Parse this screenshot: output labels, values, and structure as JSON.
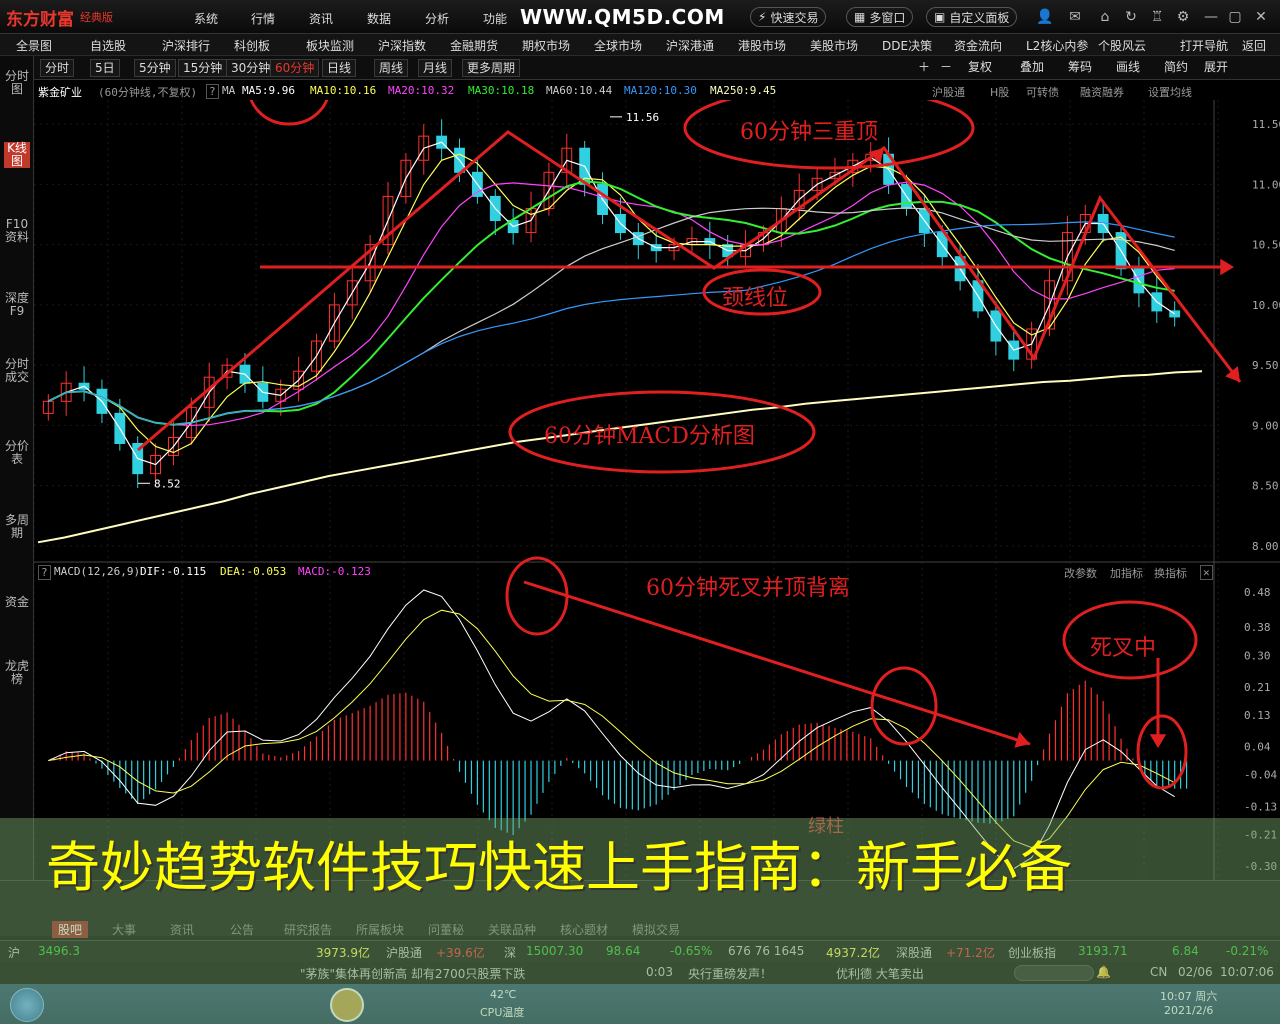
{
  "app": {
    "logo": "东方财富",
    "edition": "经典版",
    "watermark": "WWW.QM5D.COM",
    "menu": [
      "系统",
      "行情",
      "资讯",
      "数据",
      "分析",
      "功能"
    ],
    "pills": [
      "快速交易",
      "多窗口",
      "自定义面板"
    ]
  },
  "nav": [
    "全景图",
    "自选股",
    "沪深排行",
    "科创板",
    "板块监测",
    "沪深指数",
    "金融期货",
    "期权市场",
    "全球市场",
    "沪深港通",
    "港股市场",
    "美股市场",
    "DDE决策",
    "资金流向",
    "L2核心内参",
    "个股风云",
    "打开导航",
    "返回"
  ],
  "leftbar": [
    "分时图",
    "K线图",
    "F10资料",
    "深度F9",
    "分时成交",
    "分价表",
    "多周期",
    "资金",
    "龙虎榜"
  ],
  "periods": [
    "分时",
    "5日",
    "5分钟",
    "15分钟",
    "30分钟",
    "60分钟",
    "日线",
    "周线",
    "月线",
    "更多周期"
  ],
  "active_period": "60分钟",
  "tools": [
    "复权",
    "叠加",
    "筹码",
    "画线",
    "简约",
    "展开"
  ],
  "info": {
    "stock": "紫金矿业",
    "mode": "(60分钟线,不复权)",
    "ma_label": "MA",
    "ma5": "MA5:9.96",
    "ma10": "MA10:10.16",
    "ma20": "MA20:10.32",
    "ma30": "MA30:10.18",
    "ma60": "MA60:10.44",
    "ma120": "MA120:10.30",
    "ma250": "MA250:9.45",
    "right": [
      "沪股通",
      "H股",
      "可转债",
      "融资融券",
      "设置均线"
    ]
  },
  "macd": {
    "label": "MACD(12,26,9)",
    "dif": "DIF:-0.115",
    "dea": "DEA:-0.053",
    "macd": "MACD:-0.123",
    "right": [
      "改参数",
      "加指标",
      "换指标"
    ]
  },
  "price_axis": [
    "11.50",
    "11.00",
    "10.50",
    "10.00",
    "9.50",
    "9.00",
    "8.50",
    "8.00"
  ],
  "macd_axis": [
    "0.48",
    "0.38",
    "0.30",
    "0.21",
    "0.13",
    "0.04",
    "-0.04",
    "-0.13",
    "-0.21",
    "-0.30"
  ],
  "marks": {
    "high": "11.56",
    "low": "8.52"
  },
  "annotations": {
    "triple_top": "60分钟三重顶",
    "neckline": "颈线位",
    "macd_title": "60分钟MACD分析图",
    "death_cross": "60分钟死叉并顶背离",
    "in_cross": "死叉中",
    "green_bar": "绿柱"
  },
  "bottom_tabs": [
    "股吧",
    "大事",
    "资讯",
    "公告",
    "研究报告",
    "所属板块",
    "问董秘",
    "关联品种",
    "核心题材",
    "模拟交易"
  ],
  "ticker": {
    "sh_label": "沪",
    "sh_val": "3496.3",
    "sh_amt": "3973.9亿",
    "hgt": "沪股通",
    "hgt_val": "+39.6亿",
    "sz_label": "深",
    "sz_val": "15007.30",
    "sz_chg": "98.64",
    "sz_pct": "-0.65%",
    "sz_cnt": "676 76 1645",
    "sz_amt": "4937.2亿",
    "sgt": "深股通",
    "sgt_val": "+71.2亿",
    "cyb": "创业板指",
    "cyb_val": "3193.71",
    "cyb_chg": "6.84",
    "cyb_pct": "-0.21%"
  },
  "news": {
    "text": "\"茅族\"集体再创新高 却有2700只股票下跌",
    "time": "0:03",
    "text2": "央行重磅发声！",
    "text3": "优利德 大笔卖出",
    "market": "CN",
    "date": "02/06",
    "clock": "10:07:06"
  },
  "taskbar": {
    "temp": "42℃",
    "temp_label": "CPU温度",
    "time": "10:07 周六",
    "date": "2021/2/6"
  },
  "banner": "奇妙趋势软件技巧快速上手指南：新手必备",
  "colors": {
    "up": "#ff3030",
    "down": "#30d0e0",
    "ma5": "#ffffff",
    "ma10": "#ffff55",
    "ma20": "#ff44ff",
    "ma30": "#33ee33",
    "ma60": "#cccccc",
    "ma120": "#3399ff",
    "ma250": "#fffcc0",
    "annot": "#e02020"
  },
  "chart_data": {
    "type": "line",
    "title": "紫金矿业 (60分钟线,不复权)",
    "ylim": [
      7.9,
      11.7
    ],
    "series": [
      {
        "name": "收盘",
        "values": [
          9.2,
          9.35,
          9.3,
          9.1,
          8.85,
          8.6,
          8.75,
          8.9,
          9.15,
          9.4,
          9.5,
          9.35,
          9.2,
          9.3,
          9.45,
          9.7,
          10.0,
          10.2,
          10.5,
          10.9,
          11.2,
          11.4,
          11.3,
          11.1,
          10.9,
          10.7,
          10.6,
          10.8,
          11.1,
          11.3,
          11.0,
          10.75,
          10.6,
          10.5,
          10.45,
          10.5,
          10.55,
          10.5,
          10.4,
          10.5,
          10.6,
          10.8,
          10.95,
          11.05,
          11.1,
          11.2,
          11.25,
          11.0,
          10.8,
          10.6,
          10.4,
          10.2,
          9.95,
          9.7,
          9.55,
          9.8,
          10.2,
          10.6,
          10.75,
          10.6,
          10.3,
          10.1,
          9.95,
          9.9
        ]
      },
      {
        "name": "MA250",
        "values": [
          8.03,
          8.07,
          8.12,
          8.17,
          8.22,
          8.27,
          8.32,
          8.37,
          8.43,
          8.48,
          8.53,
          8.58,
          8.62,
          8.66,
          8.7,
          8.74,
          8.78,
          8.82,
          8.86,
          8.89,
          8.92,
          8.95,
          8.98,
          9.01,
          9.04,
          9.07,
          9.1,
          9.13,
          9.15,
          9.18,
          9.2,
          9.22,
          9.24,
          9.26,
          9.28,
          9.3,
          9.32,
          9.34,
          9.36,
          9.37,
          9.39,
          9.41,
          9.42,
          9.44,
          9.45
        ]
      }
    ]
  }
}
